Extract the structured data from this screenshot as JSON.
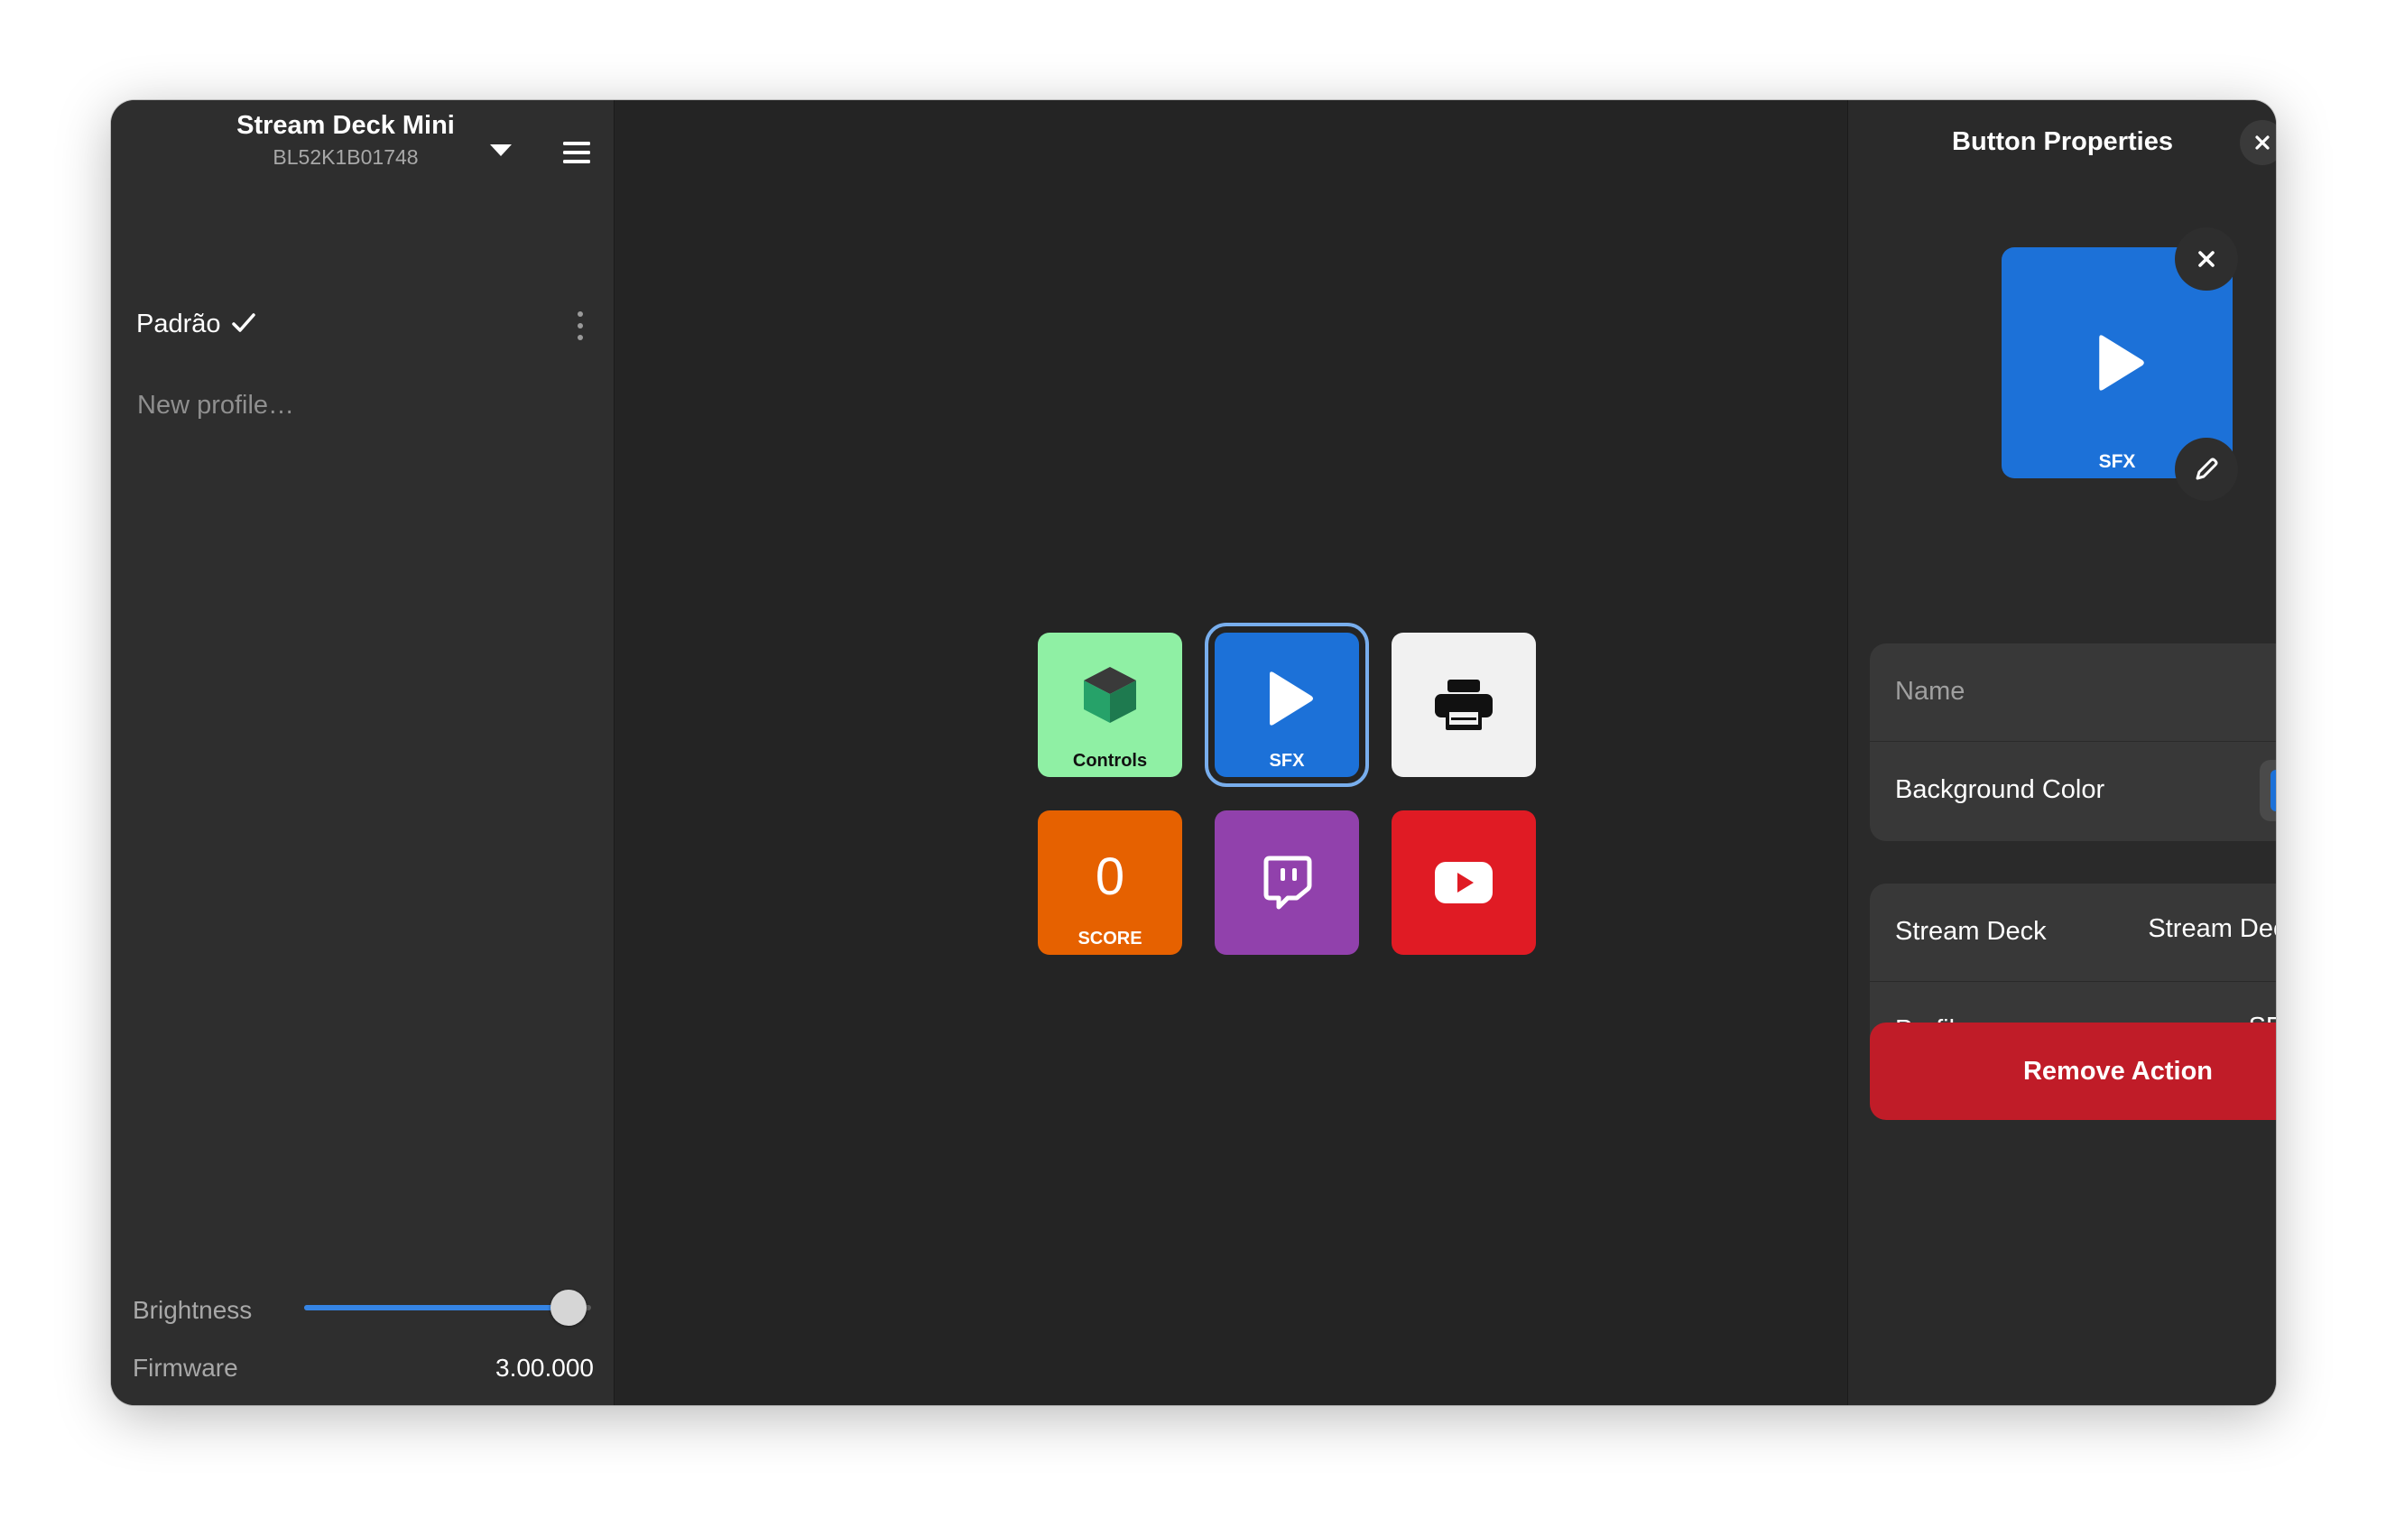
{
  "device": {
    "title": "Stream Deck Mini",
    "serial": "BL52K1B01748"
  },
  "profiles": {
    "current": "Padrão",
    "new_profile_placeholder": "New profile…"
  },
  "footer": {
    "brightness_label": "Brightness",
    "brightness_value": 1.0,
    "firmware_label": "Firmware",
    "firmware_value": "3.00.000"
  },
  "deck": {
    "keys": [
      {
        "label": "Controls",
        "bg": "#8ff0a4",
        "icon": "cube-icon",
        "text_color": "#111111"
      },
      {
        "label": "SFX",
        "bg": "#1c71d8",
        "icon": "play-icon",
        "text_color": "#ffffff",
        "selected": true
      },
      {
        "label": "",
        "bg": "#f1f1f1",
        "icon": "printer-icon",
        "text_color": "#111111"
      },
      {
        "label": "SCORE",
        "value": "0",
        "bg": "#e66100",
        "icon": "score-counter",
        "text_color": "#ffffff"
      },
      {
        "label": "",
        "bg": "#9141ac",
        "icon": "twitch-icon",
        "text_color": "#ffffff"
      },
      {
        "label": "",
        "bg": "#e01b24",
        "icon": "youtube-icon",
        "text_color": "#ffffff"
      }
    ]
  },
  "props": {
    "title": "Button Properties",
    "preview_label": "SFX",
    "preview_color": "#1c71d8",
    "name_placeholder": "Name",
    "background_color_label": "Background Color",
    "background_color_value": "#1c71d8",
    "stream_deck_label": "Stream Deck",
    "stream_deck_value": "Stream Deck",
    "profile_label": "Profile",
    "profile_value": "SFX",
    "remove_action_label": "Remove Action"
  },
  "colors": {
    "accent": "#3584e4",
    "destructive": "#c01c28"
  }
}
